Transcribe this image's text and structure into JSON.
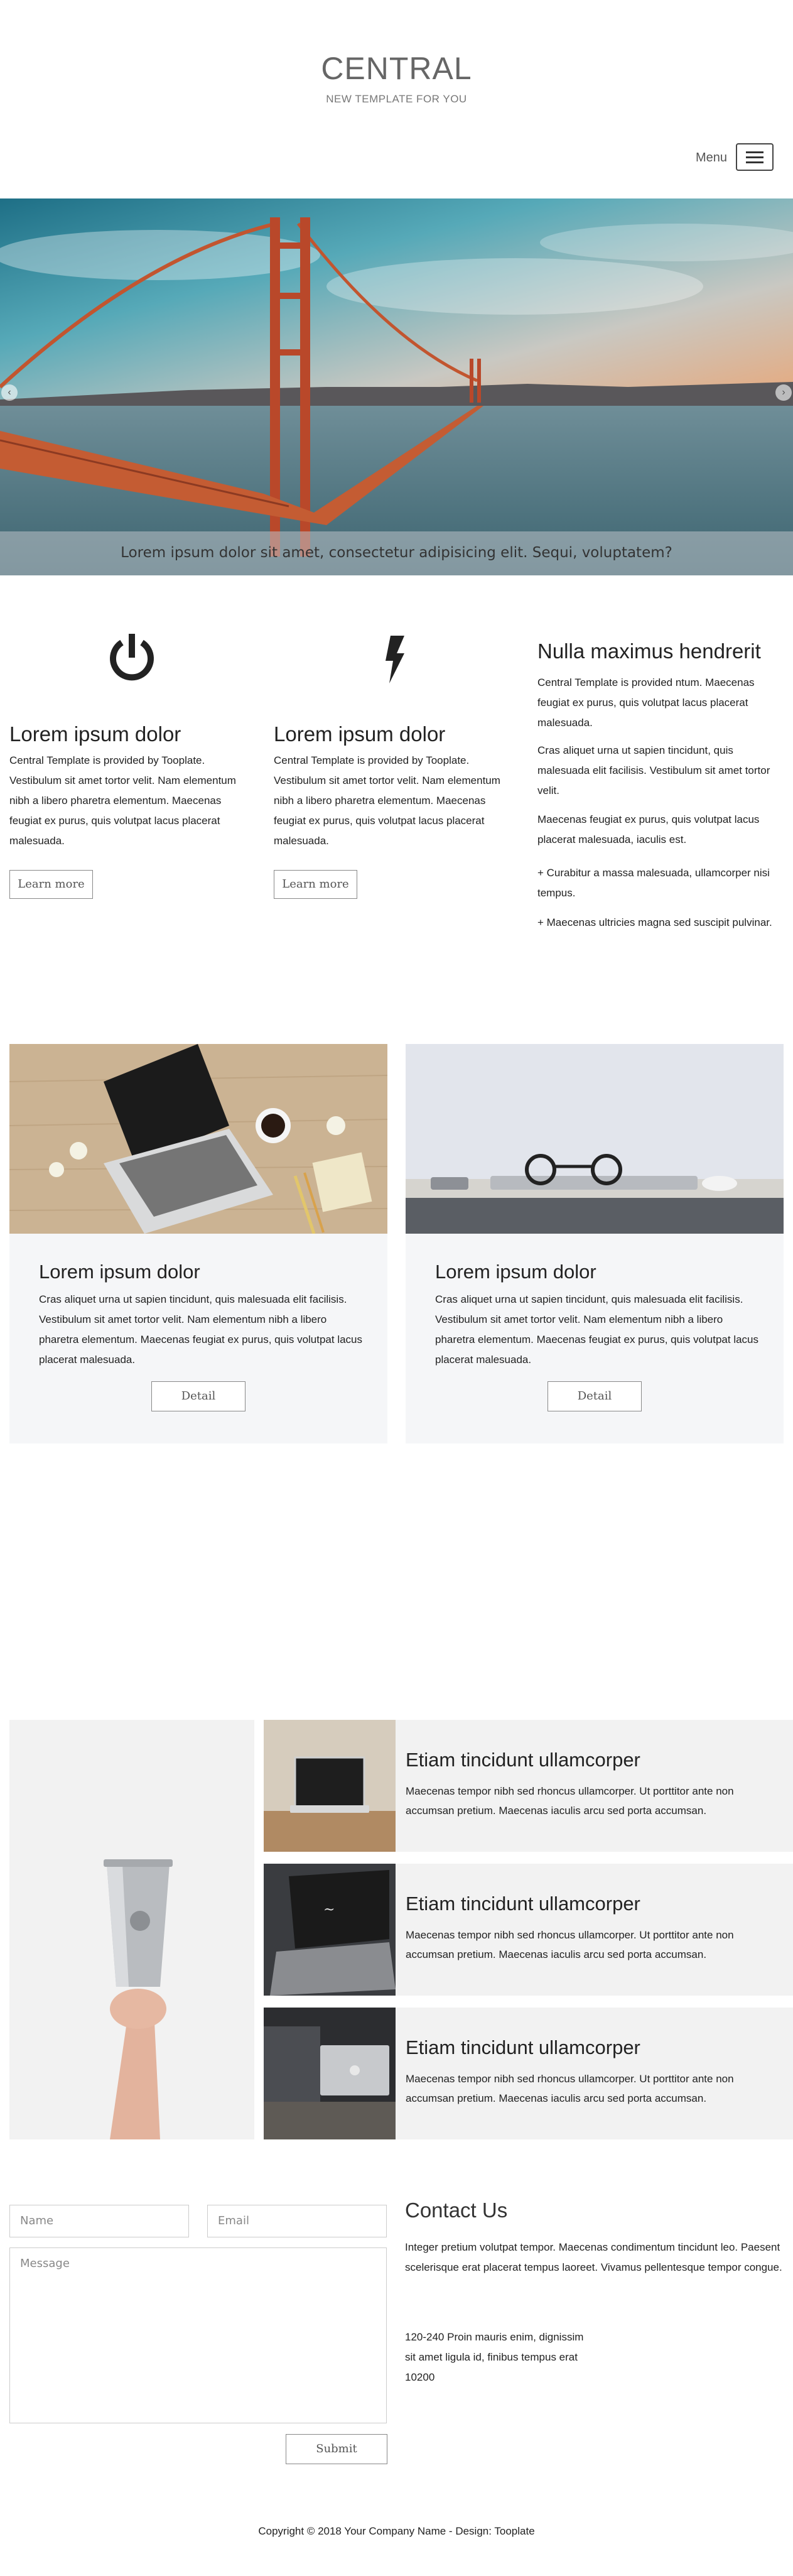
{
  "header": {
    "brand": "CENTRAL",
    "tagline": "NEW TEMPLATE FOR YOU",
    "menu_label": "Menu"
  },
  "hero": {
    "caption": "Lorem ipsum dolor sit amet, consectetur adipisicing elit. Sequi, voluptatem?",
    "prev_icon": "chevron-left-icon",
    "next_icon": "chevron-right-icon"
  },
  "features": {
    "items": [
      {
        "icon": "power-icon",
        "title": "Lorem ipsum dolor",
        "text": "Central Template is provided by Tooplate. Vestibulum sit amet tortor velit. Nam elementum nibh a libero pharetra elementum. Maecenas feugiat ex purus, quis volutpat lacus placerat malesuada.",
        "button": "Learn more"
      },
      {
        "icon": "lightning-icon",
        "title": "Lorem ipsum dolor",
        "text": "Central Template is provided by Tooplate. Vestibulum sit amet tortor velit. Nam elementum nibh a libero pharetra elementum. Maecenas feugiat ex purus, quis volutpat lacus placerat malesuada.",
        "button": "Learn more"
      }
    ],
    "side": {
      "title": "Nulla maximus hendrerit",
      "p1": "Central Template is provided ntum. Maecenas feugiat ex purus, quis volutpat lacus placerat malesuada.",
      "p2": "Cras aliquet urna ut sapien tincidunt, quis malesuada elit facilisis. Vestibulum sit amet tortor velit.",
      "p3": "Maecenas feugiat ex purus, quis volutpat lacus placerat malesuada, iaculis est.",
      "p4": "+ Curabitur a massa malesuada, ullamcorper nisi tempus.",
      "p5": "+ Maecenas ultricies magna sed suscipit pulvinar."
    }
  },
  "cards": [
    {
      "title": "Lorem ipsum dolor",
      "text": "Cras aliquet urna ut sapien tincidunt, quis malesuada elit facilisis. Vestibulum sit amet tortor velit. Nam elementum nibh a libero pharetra elementum. Maecenas feugiat ex purus, quis volutpat lacus placerat malesuada.",
      "button": "Detail"
    },
    {
      "title": "Lorem ipsum dolor",
      "text": "Cras aliquet urna ut sapien tincidunt, quis malesuada elit facilisis. Vestibulum sit amet tortor velit. Nam elementum nibh a libero pharetra elementum. Maecenas feugiat ex purus, quis volutpat lacus placerat malesuada.",
      "button": "Detail"
    }
  ],
  "products": [
    {
      "title": "Etiam tincidunt ullamcorper",
      "text": "Maecenas tempor nibh sed rhoncus ullamcorper. Ut porttitor ante non accumsan pretium. Maecenas iaculis arcu sed porta accumsan."
    },
    {
      "title": "Etiam tincidunt ullamcorper",
      "text": "Maecenas tempor nibh sed rhoncus ullamcorper. Ut porttitor ante non accumsan pretium. Maecenas iaculis arcu sed porta accumsan."
    },
    {
      "title": "Etiam tincidunt ullamcorper",
      "text": "Maecenas tempor nibh sed rhoncus ullamcorper. Ut porttitor ante non accumsan pretium. Maecenas iaculis arcu sed porta accumsan."
    }
  ],
  "contact": {
    "name_placeholder": "Name",
    "email_placeholder": "Email",
    "message_placeholder": "Message",
    "submit": "Submit",
    "title": "Contact Us",
    "text": "Integer pretium volutpat tempor. Maecenas condimentum tincidunt leo. Paesent scelerisque erat placerat tempus laoreet. Vivamus pellentesque tempor congue.",
    "address_line1": "120-240 Proin mauris enim, dignissim",
    "address_line2": "sit amet ligula id, finibus tempus erat",
    "address_line3": "10200"
  },
  "footer": {
    "copyright": "Copyright © 2018 Your Company Name - Design: Tooplate"
  },
  "colors": {
    "card_bg": "#f5f6f8",
    "product_bg": "#f2f2f2",
    "text": "#222222"
  }
}
